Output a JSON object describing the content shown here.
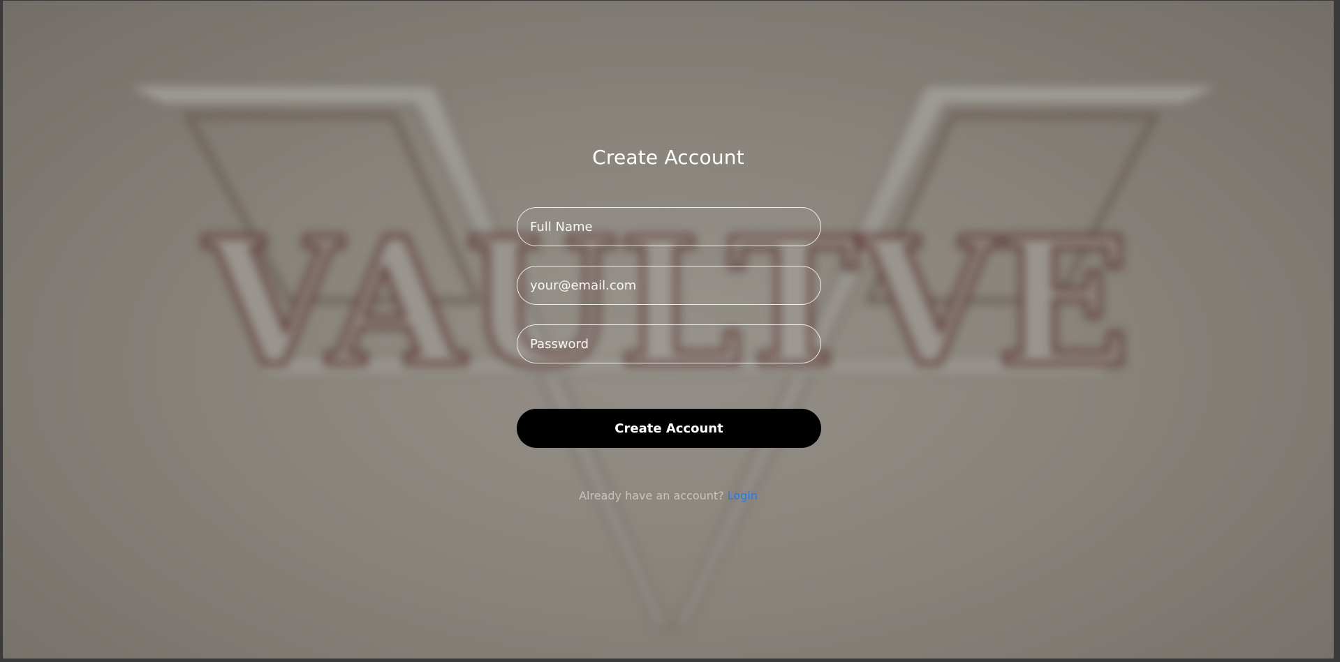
{
  "background": {
    "logo_text": "VAULTVE",
    "logo_icon": "vaultve-logo"
  },
  "form": {
    "title": "Create Account",
    "full_name_placeholder": "Full Name",
    "email_placeholder": "your@email.com",
    "password_placeholder": "Password",
    "submit_label": "Create Account"
  },
  "footer": {
    "prompt": "Already have an account?",
    "login_label": "Login"
  },
  "colors": {
    "button_bg": "#000000",
    "link": "#1f7be8",
    "overlay": "#28241e"
  }
}
